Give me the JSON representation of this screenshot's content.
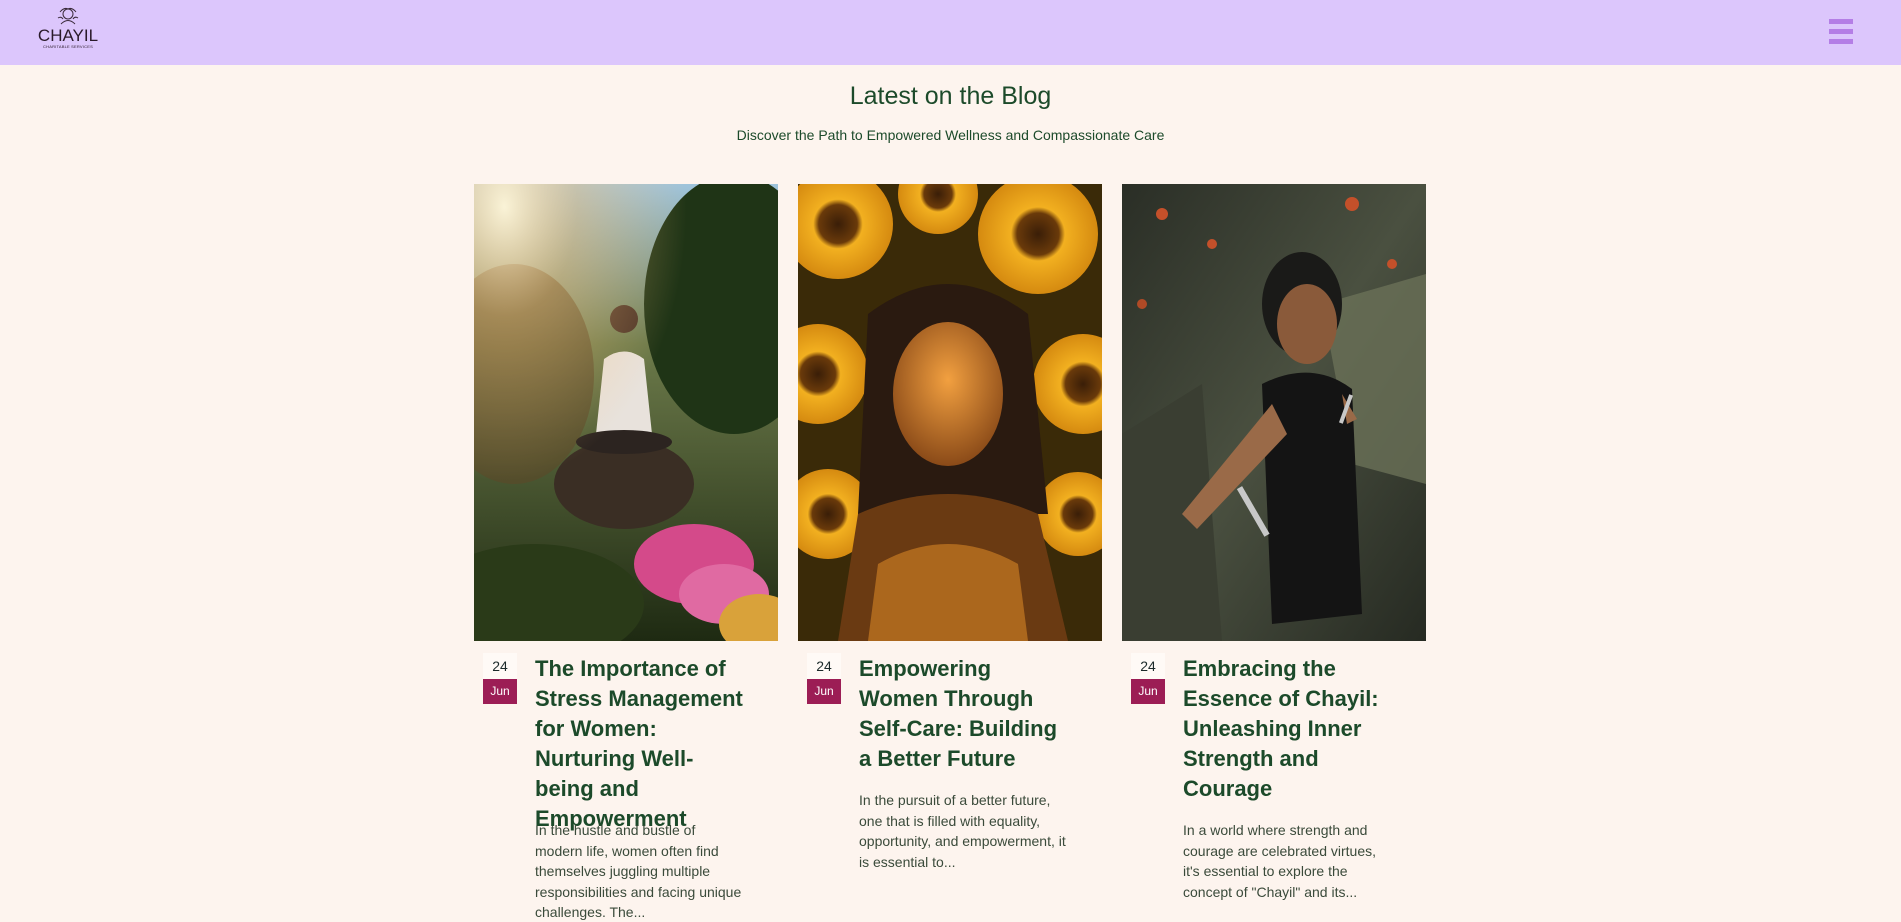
{
  "header": {
    "logo_name": "CHAYIL",
    "logo_sub": "CHARITABLE SERVICES",
    "menu_icon": "hamburger-menu-icon",
    "background": "#dcc6fc",
    "menu_color": "#b47ee6"
  },
  "main": {
    "title": "Latest on the Blog",
    "subtitle": "Discover the Path to Empowered Wellness and Compassionate Care"
  },
  "colors": {
    "page_bg": "#fdf4ee",
    "text_green": "#1c4a2a",
    "month_badge": "#9c1d55"
  },
  "posts": [
    {
      "day": "24",
      "month": "Jun",
      "title": "The Importance of Stress Management for Women: Nurturing Well-being and Empowerment",
      "excerpt": "In the hustle and bustle of modern life, women often find themselves juggling multiple responsibilities and facing unique challenges. The...",
      "image_alt": "woman meditating on rock in garden"
    },
    {
      "day": "24",
      "month": "Jun",
      "title": "Empowering Women Through Self-Care: Building a Better Future",
      "excerpt": "In the pursuit of a better future, one that is filled with equality, opportunity, and empowerment, it is essential to...",
      "image_alt": "woman with eyes closed among sunflowers"
    },
    {
      "day": "24",
      "month": "Jun",
      "title": "Embracing the Essence of Chayil: Unleashing Inner Strength and Courage",
      "excerpt": "In a world where strength and courage are celebrated virtues, it's essential to explore the concept of \"Chayil\" and its...",
      "image_alt": "woman holding blades outdoors"
    }
  ]
}
